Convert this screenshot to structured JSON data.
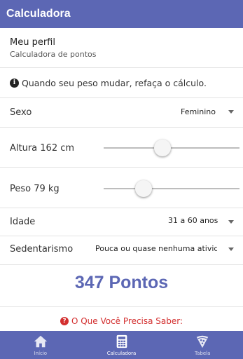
{
  "app": {
    "title": "Calculadora"
  },
  "profile": {
    "title": "Meu perfil",
    "subtitle": "Calculadora de pontos"
  },
  "info": {
    "text": "Quando seu peso mudar, refaça o cálculo."
  },
  "form": {
    "sexo": {
      "label": "Sexo",
      "value": "Feminino"
    },
    "altura": {
      "label": "Altura 162 cm",
      "value": 162,
      "slider_fraction": 0.43
    },
    "peso": {
      "label": "Peso 79 kg",
      "value": 79,
      "slider_fraction": 0.29
    },
    "idade": {
      "label": "Idade",
      "value": "31 a 60 anos"
    },
    "sedentarismo": {
      "label": "Sedentarismo",
      "value": "Pouca ou quase nenhuma atividade"
    }
  },
  "result": {
    "text": "347 Pontos"
  },
  "need_to_know": {
    "text": "O Que Você Precisa Saber:"
  },
  "nav": {
    "items": [
      {
        "label": "Início",
        "icon": "home-icon"
      },
      {
        "label": "Calculadora",
        "icon": "calculator-icon"
      },
      {
        "label": "Tabela",
        "icon": "pizza-icon"
      }
    ],
    "active": "Calculadora"
  },
  "colors": {
    "primary": "#5c67b4",
    "alert": "#d32f2f"
  }
}
